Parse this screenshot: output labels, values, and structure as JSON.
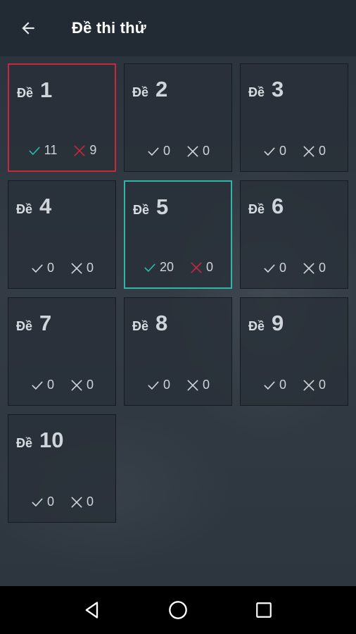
{
  "header": {
    "title": "Đề thi thử",
    "back_icon": "arrow-left-icon"
  },
  "colors": {
    "correct_active": "#2fb7a6",
    "wrong_active": "#c8283c",
    "inactive": "#cfd4d9",
    "selected_red_border": "#c8283c",
    "selected_teal_border": "#2fb7a6"
  },
  "tests": [
    {
      "prefix": "Đề",
      "number": "1",
      "correct": "11",
      "wrong": "9",
      "state": "selected-red",
      "colored": true
    },
    {
      "prefix": "Đề",
      "number": "2",
      "correct": "0",
      "wrong": "0",
      "state": "",
      "colored": false
    },
    {
      "prefix": "Đề",
      "number": "3",
      "correct": "0",
      "wrong": "0",
      "state": "",
      "colored": false
    },
    {
      "prefix": "Đề",
      "number": "4",
      "correct": "0",
      "wrong": "0",
      "state": "",
      "colored": false
    },
    {
      "prefix": "Đề",
      "number": "5",
      "correct": "20",
      "wrong": "0",
      "state": "selected-teal",
      "colored": true
    },
    {
      "prefix": "Đề",
      "number": "6",
      "correct": "0",
      "wrong": "0",
      "state": "",
      "colored": false
    },
    {
      "prefix": "Đề",
      "number": "7",
      "correct": "0",
      "wrong": "0",
      "state": "",
      "colored": false
    },
    {
      "prefix": "Đề",
      "number": "8",
      "correct": "0",
      "wrong": "0",
      "state": "",
      "colored": false
    },
    {
      "prefix": "Đề",
      "number": "9",
      "correct": "0",
      "wrong": "0",
      "state": "",
      "colored": false
    },
    {
      "prefix": "Đề",
      "number": "10",
      "correct": "0",
      "wrong": "0",
      "state": "",
      "colored": false
    }
  ],
  "navbar": {
    "back": "triangle-back-icon",
    "home": "circle-home-icon",
    "recents": "square-recents-icon"
  }
}
